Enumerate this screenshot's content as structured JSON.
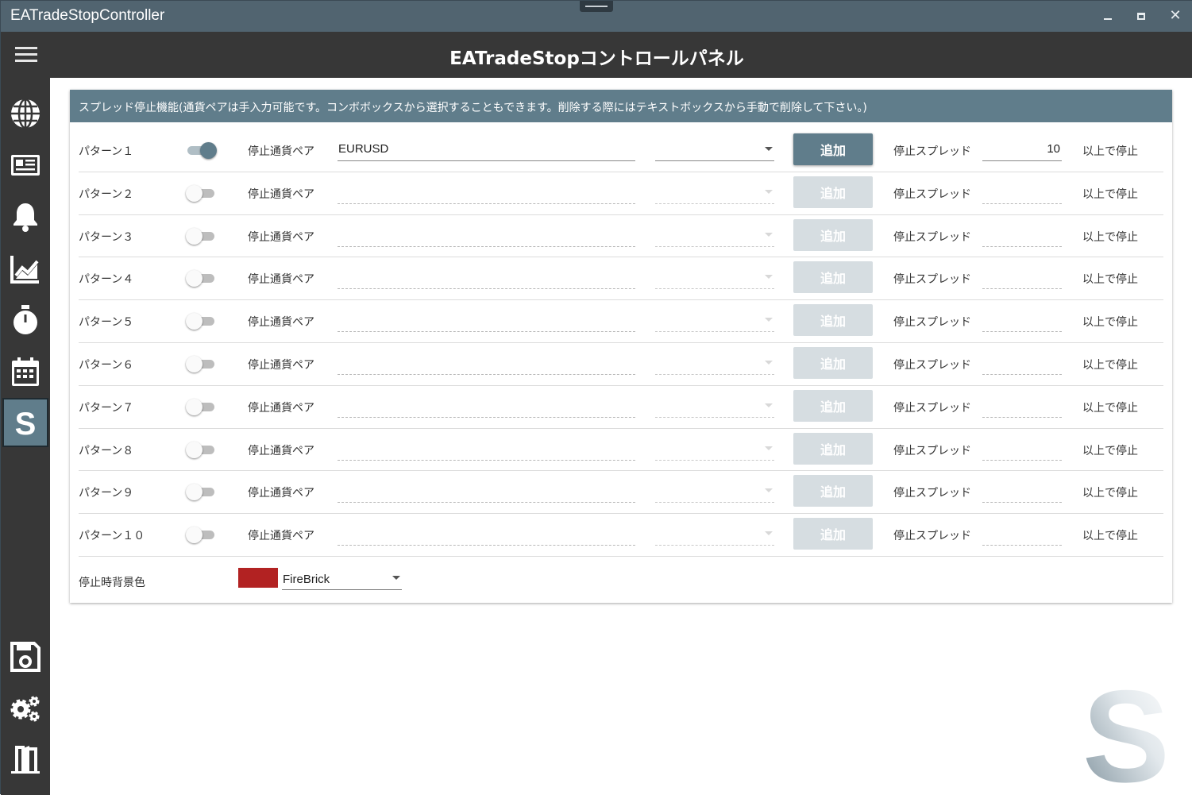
{
  "window": {
    "title": "EATradeStopController"
  },
  "header": {
    "title": "EATradeStopコントロールパネル"
  },
  "sidebar": {
    "items": [
      {
        "icon": "globe-icon"
      },
      {
        "icon": "newspaper-icon"
      },
      {
        "icon": "bell-icon"
      },
      {
        "icon": "chart-icon"
      },
      {
        "icon": "stopwatch-icon"
      },
      {
        "icon": "calendar-icon"
      },
      {
        "icon": "spread-s-icon",
        "active": true
      },
      {
        "icon": "save-icon"
      },
      {
        "icon": "settings-icon"
      },
      {
        "icon": "exit-icon"
      }
    ]
  },
  "card": {
    "header": "スプレッド停止機能(通貨ペアは手入力可能です。コンボボックスから選択することもできます。削除する際にはテキストボックスから手動で削除して下さい。)",
    "pair_label": "停止通貨ペア",
    "add_label": "追加",
    "spread_label": "停止スプレッド",
    "stop_label": "以上で停止",
    "patterns": [
      {
        "label": "パターン１",
        "enabled": true,
        "pair": "EURUSD",
        "spread": "10"
      },
      {
        "label": "パターン２",
        "enabled": false,
        "pair": "",
        "spread": ""
      },
      {
        "label": "パターン３",
        "enabled": false,
        "pair": "",
        "spread": ""
      },
      {
        "label": "パターン４",
        "enabled": false,
        "pair": "",
        "spread": ""
      },
      {
        "label": "パターン５",
        "enabled": false,
        "pair": "",
        "spread": ""
      },
      {
        "label": "パターン６",
        "enabled": false,
        "pair": "",
        "spread": ""
      },
      {
        "label": "パターン７",
        "enabled": false,
        "pair": "",
        "spread": ""
      },
      {
        "label": "パターン８",
        "enabled": false,
        "pair": "",
        "spread": ""
      },
      {
        "label": "パターン９",
        "enabled": false,
        "pair": "",
        "spread": ""
      },
      {
        "label": "パターン１０",
        "enabled": false,
        "pair": "",
        "spread": ""
      }
    ],
    "bg_color": {
      "label": "停止時背景色",
      "value": "FireBrick",
      "swatch": "#b22222"
    }
  },
  "colors": {
    "accent": "#607d8b",
    "header_bg": "#373737",
    "titlebar_bg": "#516470"
  }
}
